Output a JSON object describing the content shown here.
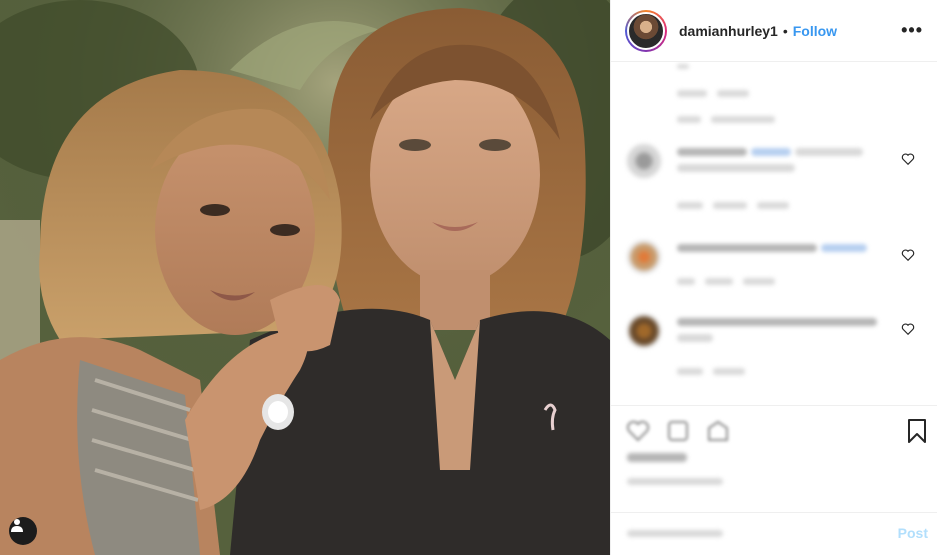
{
  "post": {
    "username": "damianhurley1",
    "separator": "•",
    "follow_label": "Follow",
    "more_label": "•••",
    "add_comment_placeholder": "",
    "post_label": "Post"
  },
  "icons": {
    "more": "more-options-icon",
    "like": "heart-icon",
    "comment": "comment-icon",
    "share": "share-icon",
    "save": "bookmark-icon",
    "user_tags": "user-tag-icon"
  },
  "colors": {
    "follow_blue": "#3897f0",
    "post_disabled": "#b2dffc",
    "divider": "#efefef",
    "text": "#262626"
  }
}
